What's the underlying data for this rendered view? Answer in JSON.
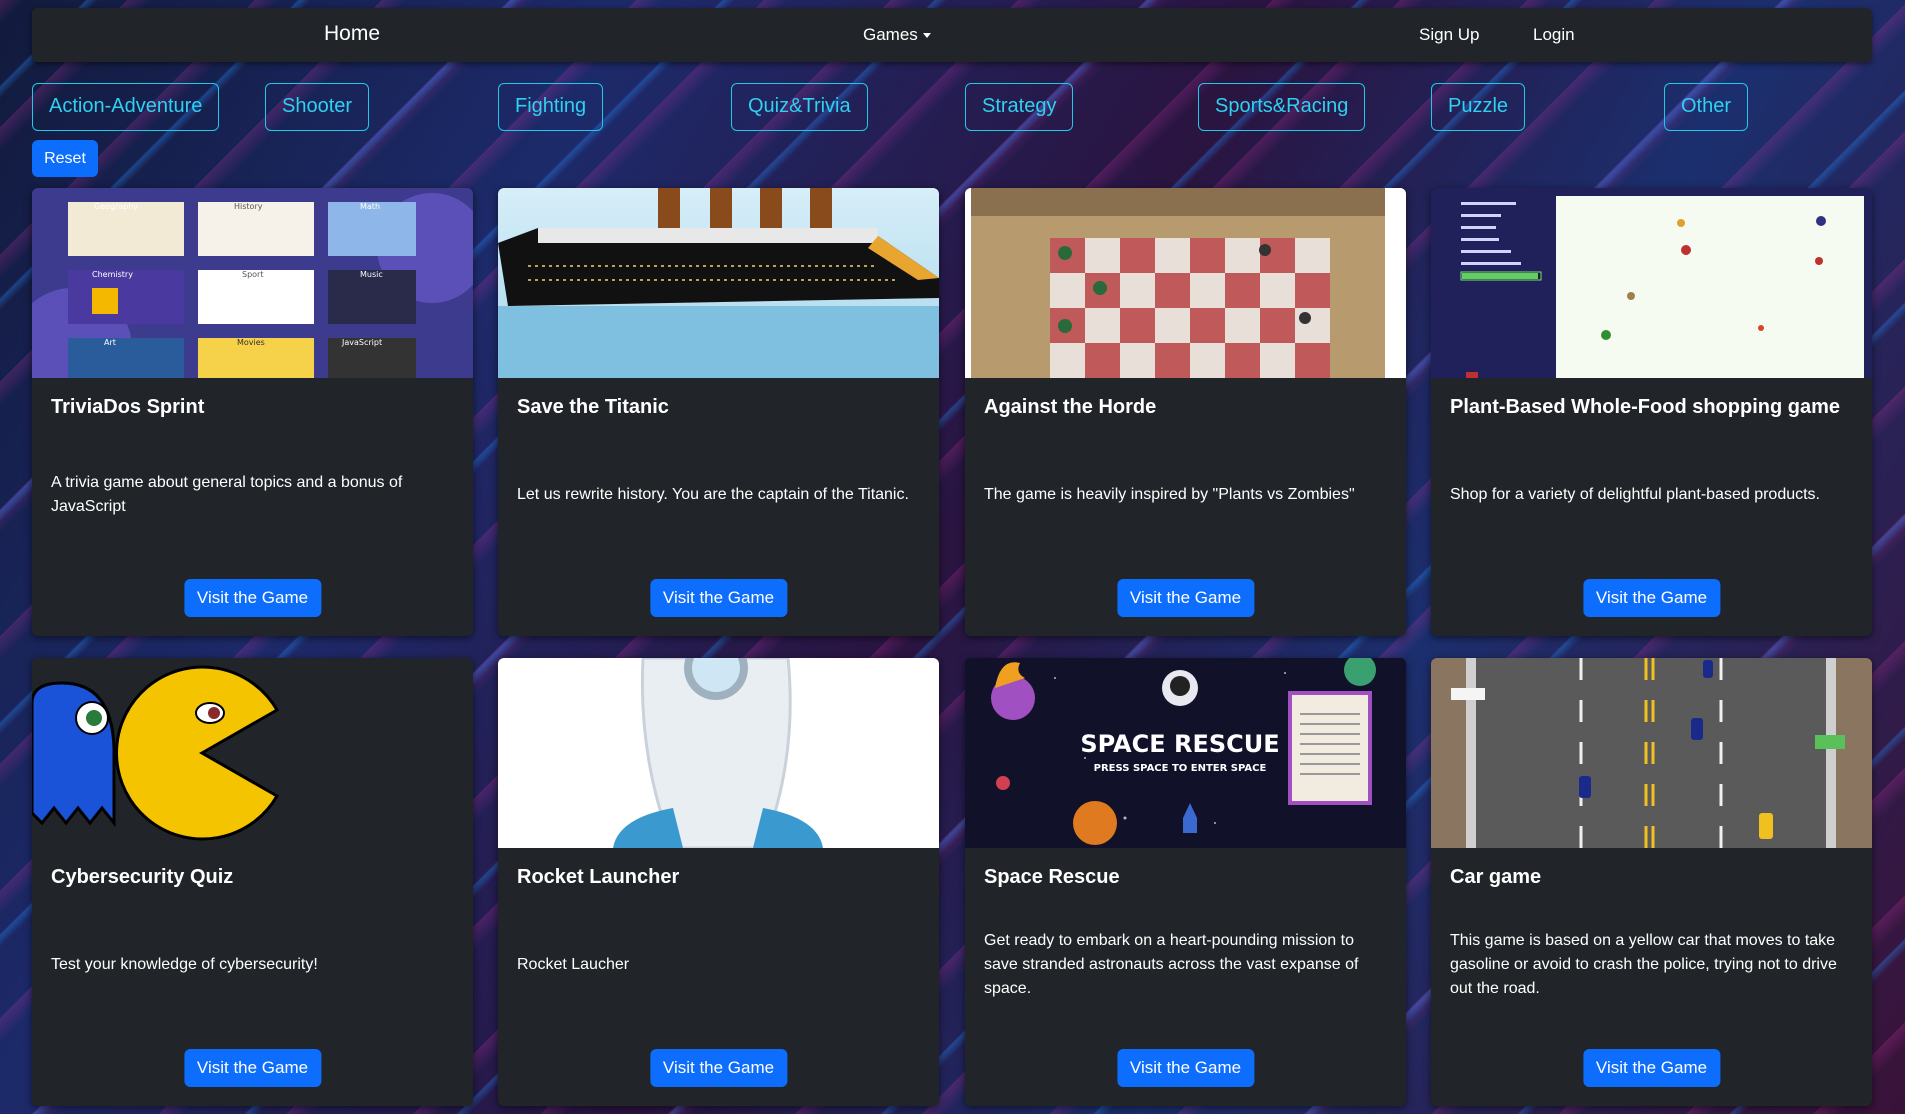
{
  "nav": {
    "home": "Home",
    "games": "Games",
    "signup": "Sign Up",
    "login": "Login"
  },
  "filters": [
    "Action-Adventure",
    "Shooter",
    "Fighting",
    "Quiz&Trivia",
    "Strategy",
    "Sports&Racing",
    "Puzzle",
    "Other"
  ],
  "reset_label": "Reset",
  "cards": [
    {
      "title": "TriviaDos Sprint",
      "text": "A trivia game about general topics and a bonus of JavaScript",
      "button": "Visit the Game",
      "thumb_labels": [
        "Geography",
        "History",
        "Math",
        "Chemistry",
        "Sport",
        "Music",
        "Art",
        "Movies",
        "JavaScript"
      ]
    },
    {
      "title": "Save the Titanic",
      "text": "Let us rewrite history. You are the captain of the Titanic.",
      "button": "Visit the Game"
    },
    {
      "title": "Against the Horde",
      "text": "The game is heavily inspired by \"Plants vs Zombies\"",
      "button": "Visit the Game"
    },
    {
      "title": "Plant-Based Whole-Food shopping game",
      "text": "Shop for a variety of delightful plant-based products.",
      "button": "Visit the Game"
    },
    {
      "title": "Cybersecurity Quiz",
      "text": "Test your knowledge of cybersecurity!",
      "button": "Visit the Game"
    },
    {
      "title": "Rocket Launcher",
      "text": "Rocket Laucher",
      "button": "Visit the Game"
    },
    {
      "title": "Space Rescue",
      "text": "Get ready to embark on a heart-pounding mission to save stranded astronauts across the vast expanse of space.",
      "button": "Visit the Game",
      "thumb_title": "SPACE RESCUE",
      "thumb_subtitle": "PRESS SPACE TO ENTER SPACE"
    },
    {
      "title": "Car game",
      "text": "This game is based on a yellow car that moves to take gasoline or avoid to crash the police, trying not to drive out the road.",
      "button": "Visit the Game"
    }
  ],
  "colors": {
    "navbar": "#212529",
    "card": "#212529",
    "primary": "#0d6efd",
    "filter": "#2fd0f0"
  }
}
